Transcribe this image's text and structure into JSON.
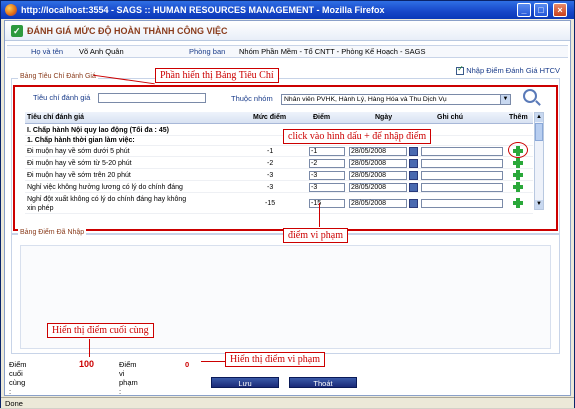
{
  "window": {
    "title": "http://localhost:3554 - SAGS :: HUMAN RESOURCES MANAGEMENT - Mozilla Firefox",
    "min": "_",
    "max": "□",
    "close": "×"
  },
  "header": {
    "title": "ĐÁNH GIÁ MỨC ĐỘ HOÀN THÀNH CÔNG VIỆC"
  },
  "employee": {
    "name_label": "Họ và tên",
    "name_value": "Võ Anh Quân",
    "dept_label": "Phòng ban",
    "dept_value": "Nhóm Phần Mềm - Tổ CNTT - Phòng Kế Hoạch - SAGS"
  },
  "checkbox_label": "Nhập Điểm Đánh Giá HTCV",
  "criteria_box": {
    "legend": "Bảng Tiêu Chí Đánh Giá",
    "filter_label": "Tiêu chí đánh giá",
    "filter_value": "",
    "group_label": "Thuộc nhóm",
    "group_value": "Nhân viên PVHK, Hành Lý, Hàng Hóa và Thu Dịch Vụ",
    "columns": [
      "Tiêu chí đánh giá",
      "Mức điểm",
      "Điểm",
      "Ngày",
      "Ghi chú",
      "Thêm"
    ],
    "groups": [
      "I. Chấp hành Nội quy lao động (Tối đa : 45)",
      "1. Chấp hành thời gian làm việc:"
    ],
    "rows": [
      {
        "name": "Đi muộn hay về sớm dưới 5 phút",
        "level": "-1",
        "score": "-1",
        "date": "28/05/2008"
      },
      {
        "name": "Đi muộn hay về sớm từ 5-20 phút",
        "level": "-2",
        "score": "-2",
        "date": "28/05/2008"
      },
      {
        "name": "Đi muộn hay về sớm trên 20 phút",
        "level": "-3",
        "score": "-3",
        "date": "28/05/2008"
      },
      {
        "name": "Nghỉ việc không hưởng lương có lý do chính đáng",
        "level": "-3",
        "score": "-3",
        "date": "28/05/2008"
      },
      {
        "name": "Nghỉ đột xuất không có lý do chính đáng hay không",
        "name2": "xin phép",
        "level": "-15",
        "score": "-15",
        "date": "28/05/2008"
      }
    ]
  },
  "entered_box": {
    "legend": "Bảng Điểm Đã Nhập"
  },
  "annotations": {
    "criteria_area": "Phần hiển thị Bảng Tiêu Chí",
    "click_plus": "click vào hình dấu + để nhập điểm",
    "violation_points": "điểm vi phạm",
    "final_score": "Hiển thị điểm cuối cùng",
    "violation_display": "Hiển thị điểm vi phạm"
  },
  "summary": {
    "final_label": "Điểm cuối cùng :",
    "final_value": "100",
    "violation_label": "Điểm vi phạm :",
    "violation_value": "0"
  },
  "buttons": {
    "save": "Lưu",
    "exit": "Thoát"
  },
  "status": "Done"
}
